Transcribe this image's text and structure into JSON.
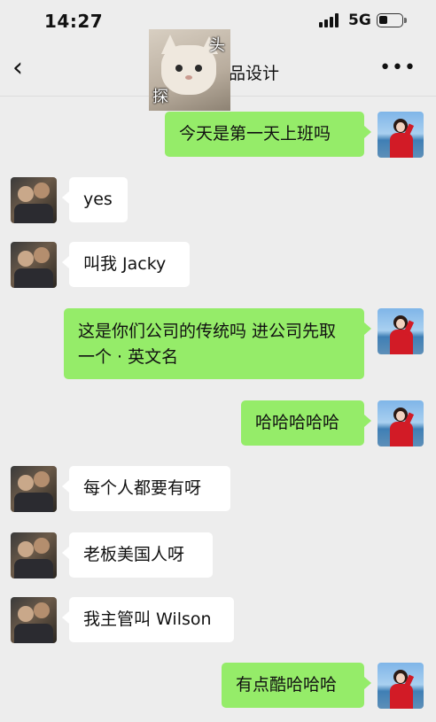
{
  "status_bar": {
    "time": "14:27",
    "network": "5G"
  },
  "header": {
    "title": "品设计",
    "sticker_chars": [
      "头",
      "探"
    ]
  },
  "messages": [
    {
      "side": "right",
      "text": "今天是第一天上班吗"
    },
    {
      "side": "left",
      "text": "yes"
    },
    {
      "side": "left",
      "text": "叫我 Jacky"
    },
    {
      "side": "right",
      "text": "这是你们公司的传统吗 进公司先取一个 · 英文名"
    },
    {
      "side": "right",
      "text": "哈哈哈哈哈"
    },
    {
      "side": "left",
      "text": "每个人都要有呀"
    },
    {
      "side": "left",
      "text": "老板美国人呀"
    },
    {
      "side": "left",
      "text": "我主管叫 Wilson"
    },
    {
      "side": "right",
      "text": "有点酷哈哈哈"
    }
  ],
  "colors": {
    "background": "#ededed",
    "outgoing_bubble": "#95ec69",
    "incoming_bubble": "#ffffff"
  }
}
